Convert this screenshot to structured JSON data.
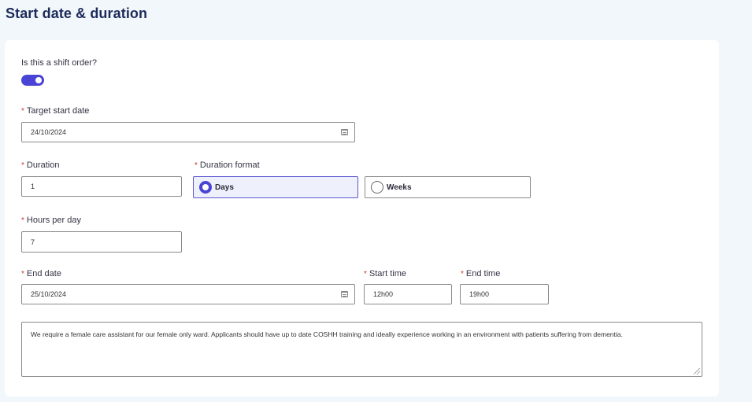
{
  "page": {
    "title": "Start date & duration"
  },
  "shift_order": {
    "label": "Is this a shift order?",
    "enabled": true
  },
  "required_marker": "*",
  "target_start_date": {
    "label": "Target start date",
    "value": "24/10/2024",
    "icon": "calendar-icon"
  },
  "duration": {
    "label": "Duration",
    "value": "1"
  },
  "duration_format": {
    "label": "Duration format",
    "options": [
      {
        "label": "Days",
        "selected": true
      },
      {
        "label": "Weeks",
        "selected": false
      }
    ]
  },
  "hours_per_day": {
    "label": "Hours per day",
    "value": "7"
  },
  "end_date": {
    "label": "End date",
    "value": "25/10/2024",
    "icon": "calendar-icon"
  },
  "start_time": {
    "label": "Start time",
    "value": "12h00"
  },
  "end_time": {
    "label": "End time",
    "value": "19h00"
  },
  "description": {
    "value": "We require a female care assistant for our female only ward. Applicants should have up to date COSHH training and ideally experience working in an environment with patients suffering from dementia."
  },
  "colors": {
    "accent": "#4a44d6",
    "required": "#d0342c",
    "title": "#1c2b5a",
    "background": "#f1f7fb"
  }
}
